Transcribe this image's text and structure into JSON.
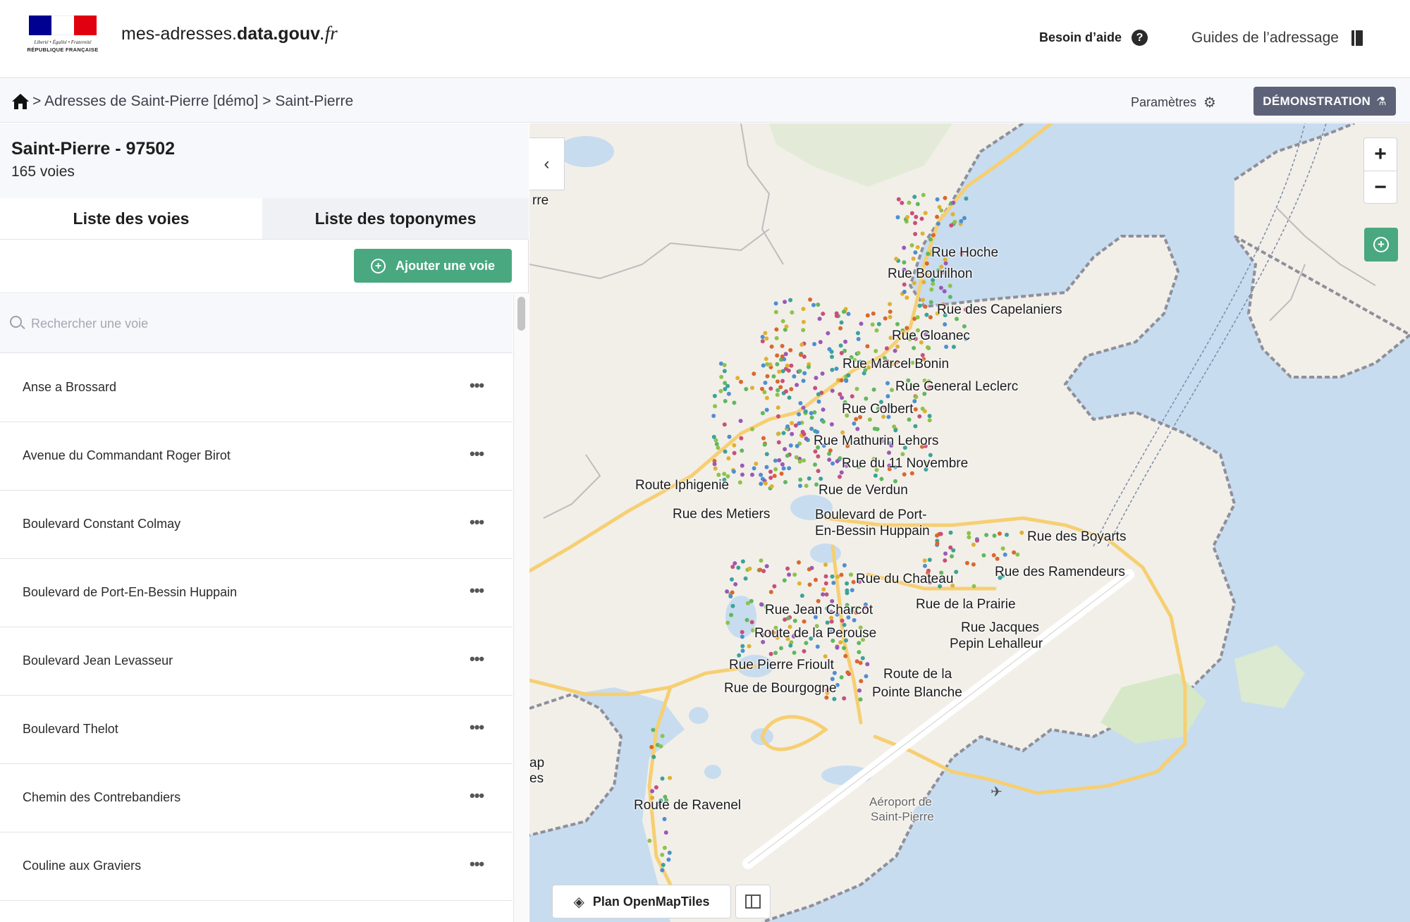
{
  "header": {
    "logo": {
      "motto": "Liberté • Égalité • Fraternité",
      "republic": "RÉPUBLIQUE FRANÇAISE",
      "flag_colors": [
        "#000091",
        "#ffffff",
        "#e1000f"
      ]
    },
    "site": {
      "prefix": "mes-adresses.",
      "bold": "data.gouv",
      "suffix": ".fr"
    },
    "help_label": "Besoin d’aide",
    "guides_label": "Guides de l’adressage"
  },
  "breadcrumb": {
    "home_icon": "home-icon",
    "path": "> Adresses de Saint-Pierre [démo] > Saint-Pierre"
  },
  "toolbar": {
    "settings_label": "Paramètres",
    "demo_label": "DÉMONSTRATION"
  },
  "commune": {
    "name": "Saint-Pierre - 97502",
    "count": "165 voies"
  },
  "tabs": [
    {
      "label": "Liste des voies",
      "active": true
    },
    {
      "label": "Liste des toponymes",
      "active": false
    }
  ],
  "add_button": "Ajouter une voie",
  "search": {
    "placeholder": "Rechercher une voie",
    "value": ""
  },
  "voies": [
    "Anse a Brossard",
    "Avenue du Commandant Roger Birot",
    "Boulevard Constant Colmay",
    "Boulevard de Port-En-Bessin Huppain",
    "Boulevard Jean Levasseur",
    "Boulevard Thelot",
    "Chemin des Contrebandiers",
    "Couline aux Graviers"
  ],
  "map": {
    "basemap_label": "Plan OpenMapTiles",
    "accent": "#4aa881",
    "labels": [
      "Rue Hoche",
      "Rue Bourilhon",
      "Rue des Capelaniers",
      "Rue Gloanec",
      "Rue Marcel Bonin",
      "Rue General Leclerc",
      "Rue Colbert",
      "Rue Mathurin Lehors",
      "Rue du 11 Novembre",
      "Route Iphigenie",
      "Rue de Verdun",
      "Rue des Metiers",
      "Boulevard de Port-",
      "En-Bessin Huppain",
      "Rue des Boyarts",
      "Rue des Ramendeurs",
      "Rue du Chateau",
      "Rue Jean Charcot",
      "Rue de la Prairie",
      "Rue Jacques",
      "Pepin Lehalleur",
      "Route de la Perouse",
      "Rue Pierre Frioult",
      "Route de la",
      "Rue de Bourgogne",
      "Pointe Blanche",
      "Route de Ravenel",
      "Aéroport de",
      "Saint-Pierre",
      "rre",
      "ap",
      "es"
    ]
  }
}
